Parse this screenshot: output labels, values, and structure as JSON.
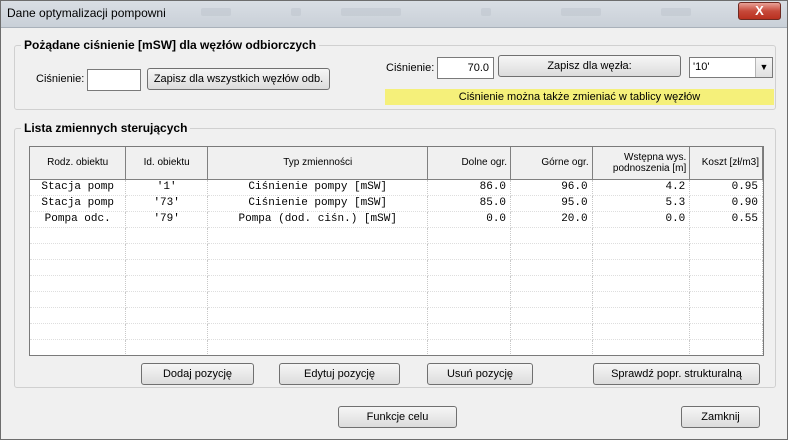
{
  "window": {
    "title": "Dane optymalizacji pompowni",
    "close_label": "X"
  },
  "pressure_group": {
    "legend": "Pożądane ciśnienie [mSW] dla węzłów odbiorczych",
    "left_label": "Ciśnienie:",
    "left_value": "",
    "save_all_label": "Zapisz dla wszystkich węzłów odb.",
    "right_label": "Ciśnienie:",
    "right_value": "70.0",
    "save_node_label": "Zapisz dla węzła:",
    "node_selected": "'10'",
    "hint": "Ciśnienie można także zmieniać w tablicy węzłów",
    "hint_color": "#f5f07a"
  },
  "vars_group": {
    "legend": "Lista zmiennych sterujących",
    "columns": [
      "Rodz. obiektu",
      "Id. obiektu",
      "Typ zmienności",
      "Dolne ogr.",
      "Górne ogr.",
      "Wstępna wys. podnoszenia [m]",
      "Koszt [zł/m3]"
    ],
    "rows": [
      [
        "Stacja pomp",
        "'1'",
        "Ciśnienie pompy [mSW]",
        "86.0",
        "96.0",
        "4.2",
        "0.95"
      ],
      [
        "Stacja pomp",
        "'73'",
        "Ciśnienie pompy [mSW]",
        "85.0",
        "95.0",
        "5.3",
        "0.90"
      ],
      [
        "Pompa odc.",
        "'79'",
        "Pompa (dod. ciśn.) [mSW]",
        "0.0",
        "20.0",
        "0.0",
        "0.55"
      ]
    ],
    "empty_rows": 8
  },
  "actions": {
    "add": "Dodaj pozycję",
    "edit": "Edytuj pozycję",
    "remove": "Usuń pozycję",
    "check": "Sprawdź popr. strukturalną"
  },
  "footer": {
    "objective": "Funkcje celu",
    "close": "Zamknij"
  }
}
